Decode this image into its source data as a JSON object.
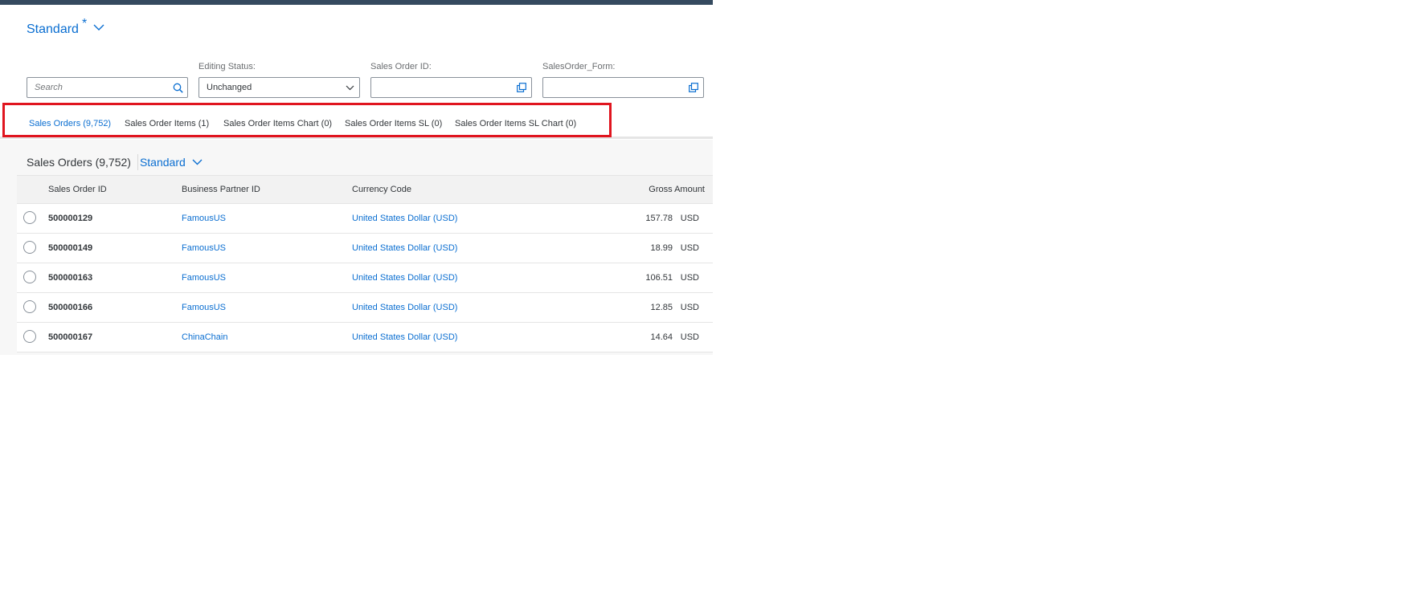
{
  "variant": {
    "name": "Standard",
    "modified": "*"
  },
  "filters": {
    "search_placeholder": "Search",
    "editing_status": {
      "label": "Editing Status:",
      "value": "Unchanged"
    },
    "sales_order_id": {
      "label": "Sales Order ID:",
      "value": ""
    },
    "sales_order_form": {
      "label": "SalesOrder_Form:",
      "value": ""
    }
  },
  "tabs": [
    {
      "label": "Sales Orders (9,752)",
      "active": true
    },
    {
      "label": "Sales Order Items (1)",
      "active": false
    },
    {
      "label": "Sales Order Items Chart (0)",
      "active": false
    },
    {
      "label": "Sales Order Items SL (0)",
      "active": false
    },
    {
      "label": "Sales Order Items SL Chart (0)",
      "active": false
    }
  ],
  "table": {
    "title": "Sales Orders (9,752)",
    "variant": "Standard",
    "columns": {
      "id": "Sales Order ID",
      "partner": "Business Partner ID",
      "currency": "Currency Code",
      "gross": "Gross Amount"
    },
    "rows": [
      {
        "id": "500000129",
        "partner": "FamousUS",
        "currency": "United States Dollar (USD)",
        "amount": "157.78",
        "unit": "USD"
      },
      {
        "id": "500000149",
        "partner": "FamousUS",
        "currency": "United States Dollar (USD)",
        "amount": "18.99",
        "unit": "USD"
      },
      {
        "id": "500000163",
        "partner": "FamousUS",
        "currency": "United States Dollar (USD)",
        "amount": "106.51",
        "unit": "USD"
      },
      {
        "id": "500000166",
        "partner": "FamousUS",
        "currency": "United States Dollar (USD)",
        "amount": "12.85",
        "unit": "USD"
      },
      {
        "id": "500000167",
        "partner": "ChinaChain",
        "currency": "United States Dollar (USD)",
        "amount": "14.64",
        "unit": "USD"
      }
    ]
  },
  "colors": {
    "accent": "#0a6ed1",
    "shell": "#354a5f",
    "highlight": "#e0151f"
  }
}
